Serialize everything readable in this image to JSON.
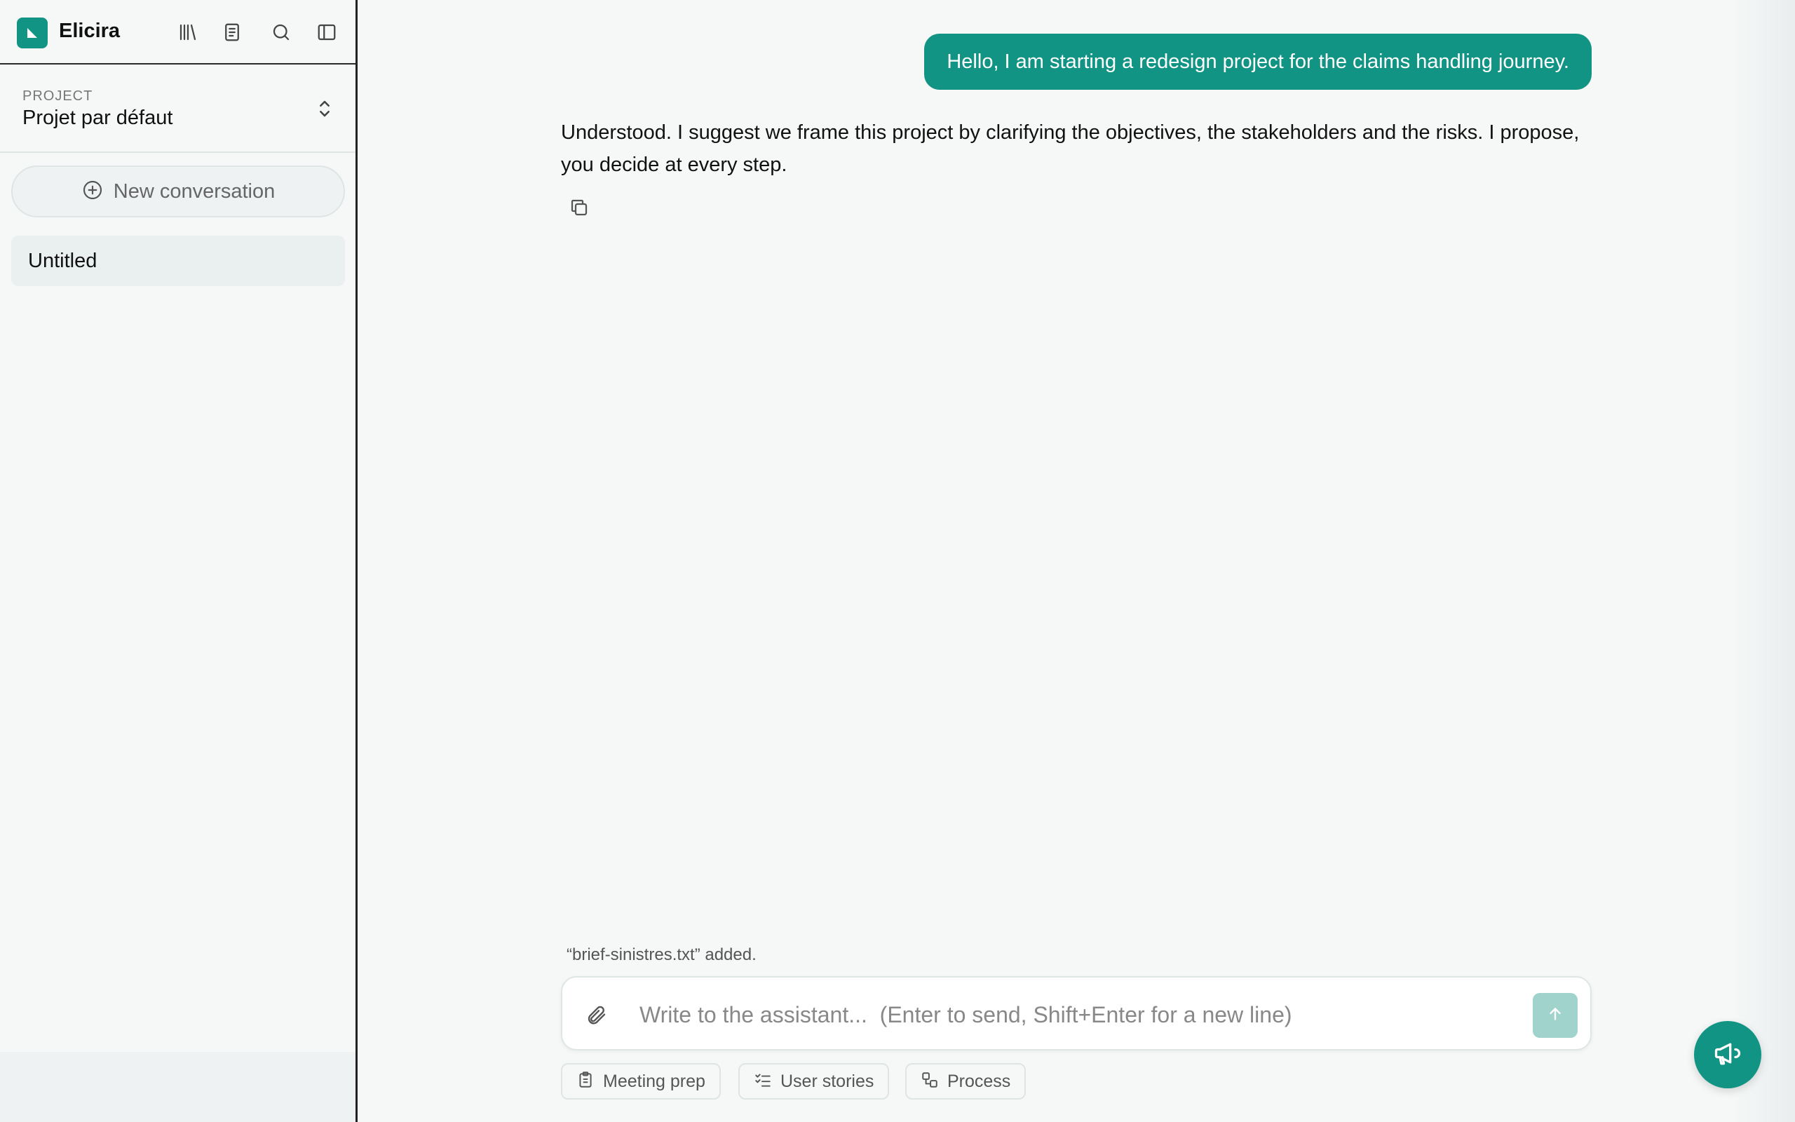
{
  "app": {
    "name": "Elicira"
  },
  "sidebar": {
    "project_label": "PROJECT",
    "project_name": "Projet par défaut",
    "new_conversation_label": "New conversation",
    "conversations": [
      {
        "title": "Untitled"
      }
    ],
    "top_icons": [
      "library-icon",
      "notebook-icon",
      "search-icon",
      "sidebar-toggle-icon"
    ]
  },
  "chat": {
    "messages": [
      {
        "role": "user",
        "text": "Hello, I am starting a redesign project for the claims handling journey."
      },
      {
        "role": "assistant",
        "text": "Understood. I suggest we frame this project by clarifying the objectives, the stakeholders and the risks. I propose, you decide at every step."
      }
    ],
    "attachment_note": "“brief-sinistres.txt” added.",
    "composer_placeholder": "Write to the assistant...  (Enter to send, Shift+Enter for a new line)",
    "composer_value": "",
    "chips": [
      {
        "label": "Meeting prep",
        "icon": "clipboard-icon"
      },
      {
        "label": "User stories",
        "icon": "checklist-icon"
      },
      {
        "label": "Process",
        "icon": "process-icon"
      }
    ]
  },
  "colors": {
    "accent": "#129484",
    "send_disabled": "#9fd3cc",
    "background": "#f6f8f8"
  }
}
